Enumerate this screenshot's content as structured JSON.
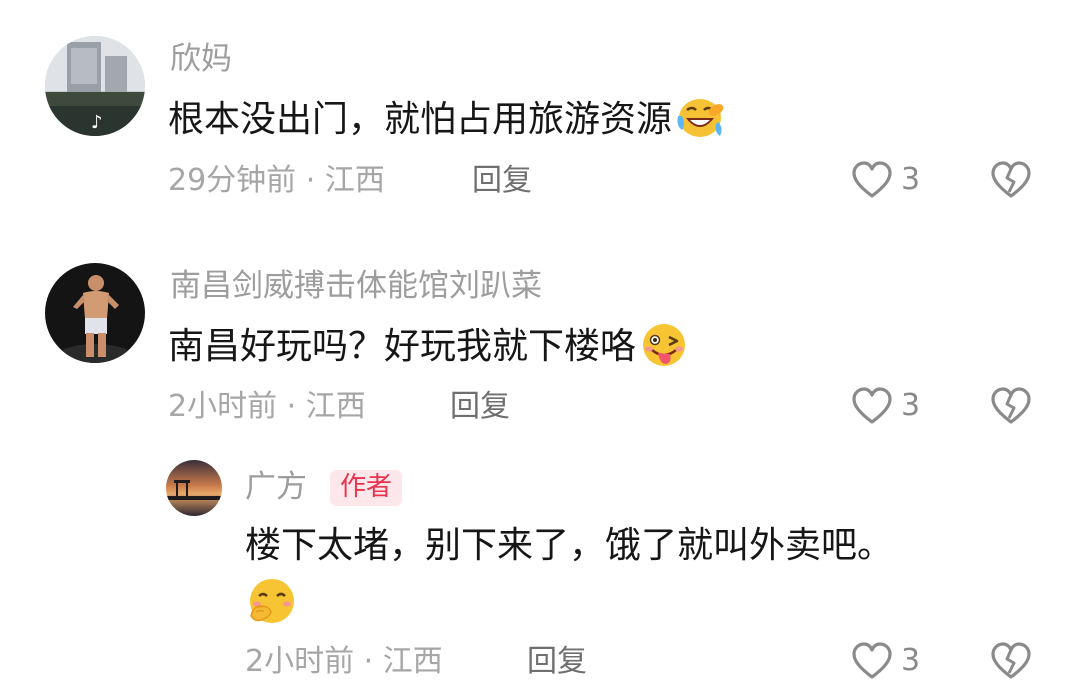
{
  "comments": [
    {
      "username": "欣妈",
      "text": "根本没出门，就怕占用旅游资源",
      "emoji": "laughing-crying-emoji",
      "time": "29分钟前",
      "separator": "·",
      "location": "江西",
      "reply_label": "回复",
      "likes": "3"
    },
    {
      "username": "南昌剑威搏击体能馆刘趴菜",
      "text": "南昌好玩吗？好玩我就下楼咯",
      "emoji": "winking-tongue-emoji",
      "time": "2小时前",
      "separator": "·",
      "location": "江西",
      "reply_label": "回复",
      "likes": "3"
    }
  ],
  "reply": {
    "username": "广方",
    "badge": "作者",
    "text": "楼下太堵，别下来了，饿了就叫外卖吧。",
    "emoji": "shushing-smile-emoji",
    "time": "2小时前",
    "separator": "·",
    "location": "江西",
    "reply_label": "回复",
    "likes": "3"
  },
  "colors": {
    "username": "#9d9d9d",
    "body": "#161616",
    "meta": "#a6a6a6",
    "badge_bg": "#fde7ea",
    "badge_text": "#e8344e"
  }
}
